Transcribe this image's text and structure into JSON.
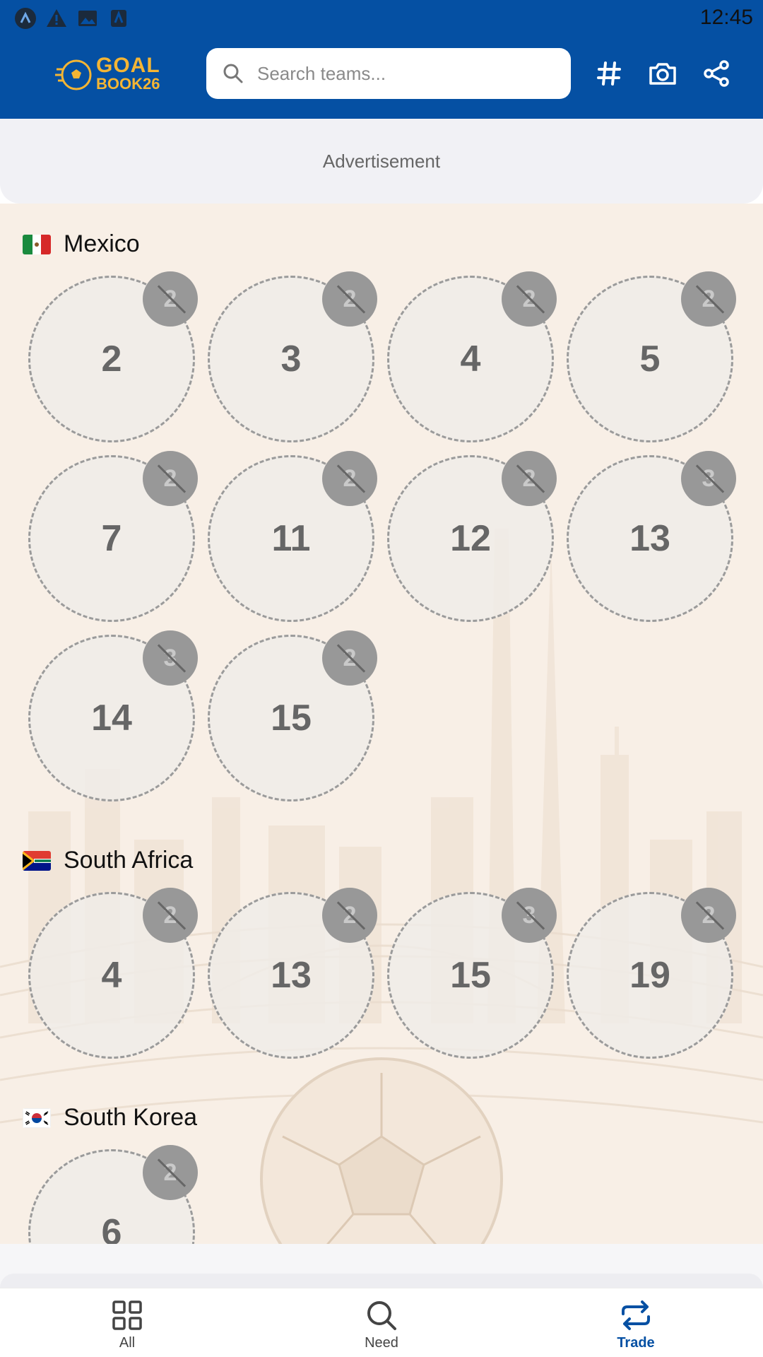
{
  "status_bar": {
    "time": "12:45"
  },
  "header": {
    "logo_line1": "GOAL",
    "logo_line2": "BOOK26",
    "search_placeholder": "Search teams...",
    "search_value": ""
  },
  "ad": {
    "label": "Advertisement"
  },
  "teams": [
    {
      "name": "Mexico",
      "stickers": [
        {
          "number": "2",
          "count": "2"
        },
        {
          "number": "3",
          "count": "2"
        },
        {
          "number": "4",
          "count": "2"
        },
        {
          "number": "5",
          "count": "2"
        },
        {
          "number": "7",
          "count": "2"
        },
        {
          "number": "11",
          "count": "2"
        },
        {
          "number": "12",
          "count": "2"
        },
        {
          "number": "13",
          "count": "3"
        },
        {
          "number": "14",
          "count": "3"
        },
        {
          "number": "15",
          "count": "2"
        }
      ]
    },
    {
      "name": "South Africa",
      "stickers": [
        {
          "number": "4",
          "count": "2"
        },
        {
          "number": "13",
          "count": "2"
        },
        {
          "number": "15",
          "count": "3"
        },
        {
          "number": "19",
          "count": "2"
        }
      ]
    },
    {
      "name": "South Korea",
      "stickers": [
        {
          "number": "6",
          "count": "2"
        }
      ]
    }
  ],
  "nav": [
    {
      "label": "All",
      "icon": "grid-icon",
      "active": false
    },
    {
      "label": "Need",
      "icon": "search-icon",
      "active": false
    },
    {
      "label": "Trade",
      "icon": "trade-arrows-icon",
      "active": true
    }
  ],
  "colors": {
    "primary": "#0550a3",
    "accent": "#f4b534",
    "badge": "#989898"
  }
}
